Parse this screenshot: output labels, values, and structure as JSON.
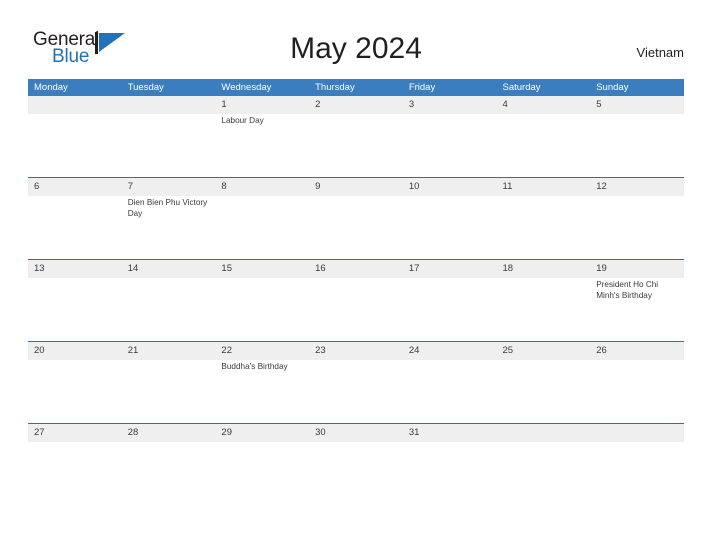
{
  "logo": {
    "word_one": "General",
    "word_two": "Blue",
    "mark": "triangle-flag-icon",
    "mark_color": "#2272b5"
  },
  "header": {
    "title": "May 2024",
    "country": "Vietnam"
  },
  "theme": {
    "header_blue": "#3b7ebf",
    "rule_blue": "#2272b5",
    "band_gray": "#efefef",
    "text": "#3b3b3b"
  },
  "calendar": {
    "month": "May",
    "year": "2024",
    "weekday_headers": [
      "Monday",
      "Tuesday",
      "Wednesday",
      "Thursday",
      "Friday",
      "Saturday",
      "Sunday"
    ],
    "weeks": [
      {
        "days": [
          {
            "date": "",
            "events": []
          },
          {
            "date": "",
            "events": []
          },
          {
            "date": "1",
            "events": [
              "Labour Day"
            ]
          },
          {
            "date": "2",
            "events": []
          },
          {
            "date": "3",
            "events": []
          },
          {
            "date": "4",
            "events": []
          },
          {
            "date": "5",
            "events": []
          }
        ]
      },
      {
        "days": [
          {
            "date": "6",
            "events": []
          },
          {
            "date": "7",
            "events": [
              "Dien Bien Phu Victory Day"
            ]
          },
          {
            "date": "8",
            "events": []
          },
          {
            "date": "9",
            "events": []
          },
          {
            "date": "10",
            "events": []
          },
          {
            "date": "11",
            "events": []
          },
          {
            "date": "12",
            "events": []
          }
        ]
      },
      {
        "days": [
          {
            "date": "13",
            "events": []
          },
          {
            "date": "14",
            "events": []
          },
          {
            "date": "15",
            "events": []
          },
          {
            "date": "16",
            "events": []
          },
          {
            "date": "17",
            "events": []
          },
          {
            "date": "18",
            "events": []
          },
          {
            "date": "19",
            "events": [
              "President Ho Chi Minh's Birthday"
            ]
          }
        ]
      },
      {
        "days": [
          {
            "date": "20",
            "events": []
          },
          {
            "date": "21",
            "events": []
          },
          {
            "date": "22",
            "events": [
              "Buddha's Birthday"
            ]
          },
          {
            "date": "23",
            "events": []
          },
          {
            "date": "24",
            "events": []
          },
          {
            "date": "25",
            "events": []
          },
          {
            "date": "26",
            "events": []
          }
        ]
      },
      {
        "days": [
          {
            "date": "27",
            "events": []
          },
          {
            "date": "28",
            "events": []
          },
          {
            "date": "29",
            "events": []
          },
          {
            "date": "30",
            "events": []
          },
          {
            "date": "31",
            "events": []
          },
          {
            "date": "",
            "events": []
          },
          {
            "date": "",
            "events": []
          }
        ]
      }
    ]
  }
}
